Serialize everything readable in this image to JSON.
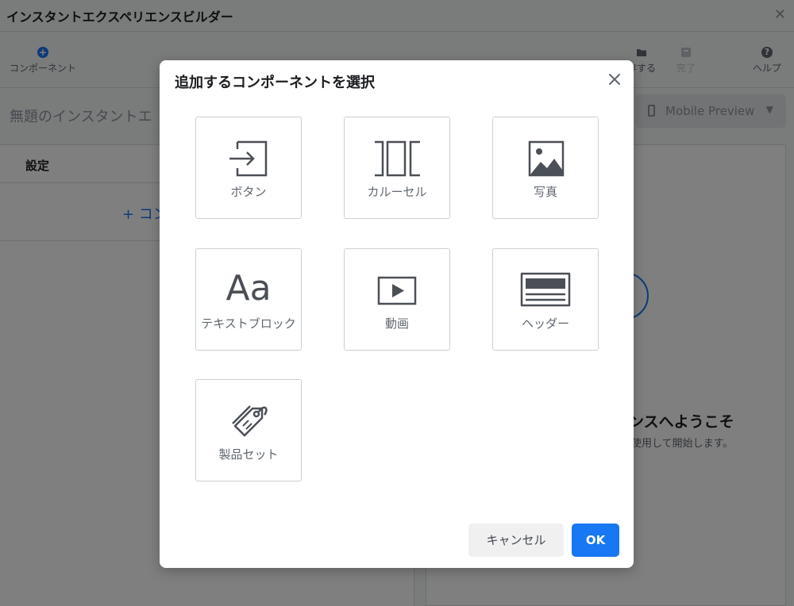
{
  "app": {
    "title": "インスタントエクスペリエンスビルダー",
    "document_name": "無題のインスタントエ",
    "toolbar": {
      "add_component_label": "コンポーネント",
      "save_label": "存する",
      "done_label": "完了",
      "help_label": "ヘルプ"
    },
    "preview_select": {
      "label": "Mobile Preview"
    },
    "left_panel": {
      "tab_settings": "設定",
      "add_component_link": "+ コン"
    },
    "right_panel": {
      "welcome_title": "エンスへようこそ",
      "welcome_subtitle": "使用して開始します。"
    }
  },
  "modal": {
    "title": "追加するコンポーネントを選択",
    "tiles": [
      {
        "label": "ボタン",
        "icon": "button-icon"
      },
      {
        "label": "カルーセル",
        "icon": "carousel-icon"
      },
      {
        "label": "写真",
        "icon": "photo-icon"
      },
      {
        "label": "テキストブロック",
        "icon": "text-block-icon",
        "icon_text": "Aa"
      },
      {
        "label": "動画",
        "icon": "video-icon"
      },
      {
        "label": "ヘッダー",
        "icon": "header-icon"
      },
      {
        "label": "製品セット",
        "icon": "product-set-icon"
      }
    ],
    "cancel_label": "キャンセル",
    "ok_label": "OK"
  },
  "colors": {
    "accent": "#1877f2",
    "icon_gray": "#4b4f56",
    "label_gray": "#606770"
  }
}
